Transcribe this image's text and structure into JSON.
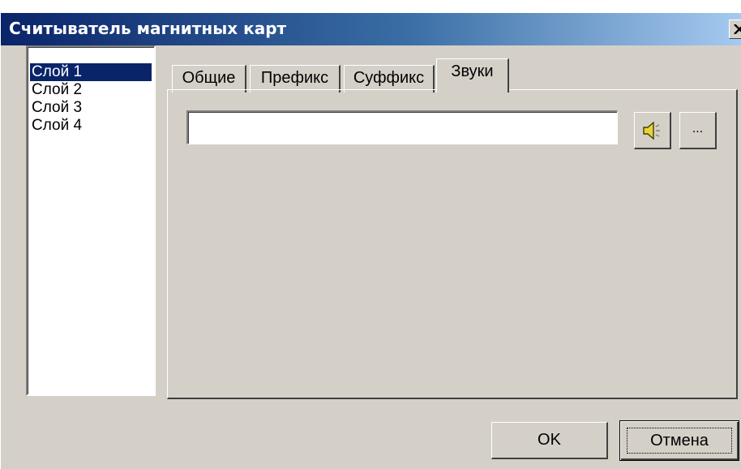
{
  "window": {
    "title": "Считыватель магнитных карт"
  },
  "layers": {
    "items": [
      "Слой 1",
      "Слой 2",
      "Слой 3",
      "Слой 4"
    ],
    "selected": "Слой 1"
  },
  "tabs": {
    "items": [
      "Общие",
      "Префикс",
      "Суффикс",
      "Звуки"
    ],
    "active": "Звуки"
  },
  "sounds": {
    "file_value": "",
    "browse_label": "..."
  },
  "icons": {
    "play": "speaker-icon",
    "close": "close-icon"
  },
  "buttons": {
    "ok_label": "OK",
    "cancel_label": "Отмена"
  },
  "colors": {
    "title_start": "#0a246a",
    "title_end": "#a6caf0",
    "face": "#d4d0c8",
    "selection": "#0a246a",
    "speaker_fill": "#e8d43a"
  }
}
